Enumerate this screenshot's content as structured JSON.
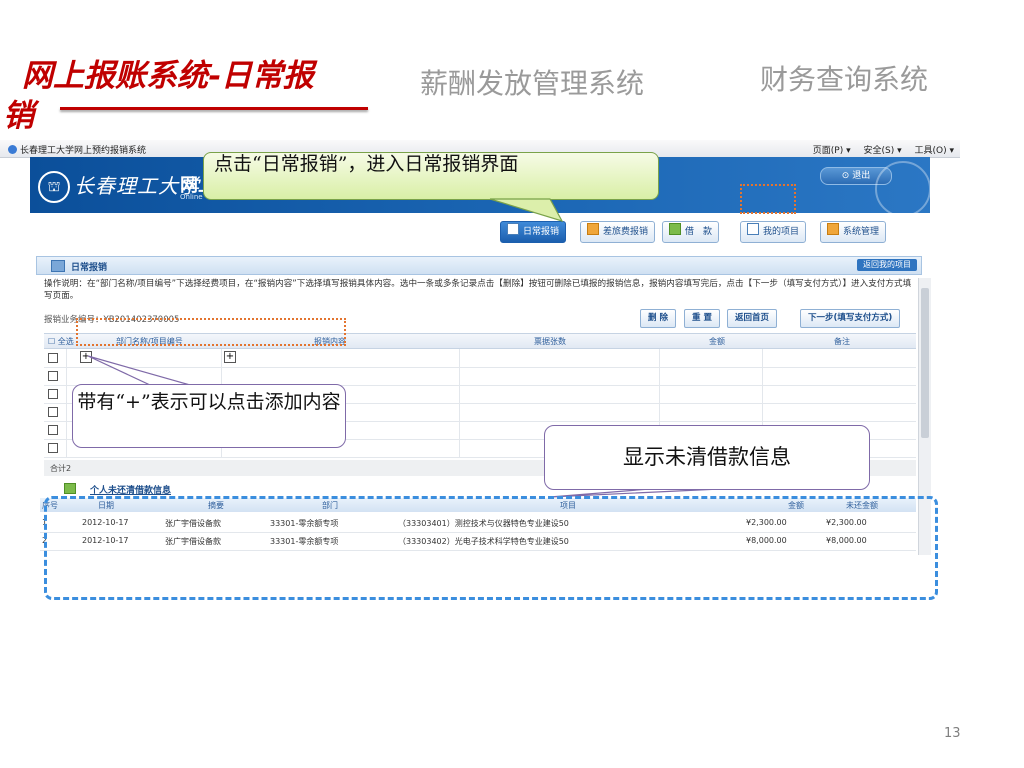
{
  "slide": {
    "title_line1": "网上报账系统-日常报",
    "title_line2": "销",
    "salary_system": "薪酬发放管理系统",
    "finance_system": "财务查询系统",
    "page_number": "13"
  },
  "browser": {
    "tab_title": "长春理工大学网上预约报销系统",
    "tools": [
      "页面(P) ▾",
      "安全(S) ▾",
      "工具(O) ▾"
    ]
  },
  "banner": {
    "university": "长春理工大学",
    "system_prefix": "网上",
    "subtitle": "Online",
    "logout": "退出"
  },
  "nav": {
    "daily": "日常报销",
    "travel": "差旅费报销",
    "loan": "借　款",
    "my_items": "我的项目",
    "admin": "系统管理"
  },
  "panel": {
    "title": "日常报销",
    "my_items_btn": "返回我的项目",
    "instruction": "操作说明：在“部门名称/项目编号”下选择经费项目，在“报销内容”下选择填写报销具体内容。选中一条或多条记录点击【删除】按钮可删除已填报的报销信息，报销内容填写完后，点击【下一步（填写支付方式）】进入支付方式填写页面。",
    "biz_no": "报销业务编号：YB201402370005"
  },
  "actions": {
    "delete": "删 除",
    "reset": "重 置",
    "home": "返回首页",
    "next": "下一步(填写支付方式)"
  },
  "grid": {
    "headers": [
      "全选",
      "部门名称/项目编号",
      "报销内容",
      "票据张数",
      "金额",
      "备注"
    ],
    "row_count": 6,
    "total_label": "合计2"
  },
  "debt": {
    "title": "个人未还清借款信息",
    "headers": [
      "序号",
      "日期",
      "摘要",
      "部门",
      "项目",
      "金额",
      "未还金额"
    ],
    "rows": [
      {
        "no": "1",
        "date": "2012-10-17",
        "summary": "张广宇借设备款",
        "dept": "33301-零余额专项",
        "project": "（33303401）测控技术与仪器特色专业建设50",
        "amount": "¥2,300.00",
        "unpaid": "¥2,300.00"
      },
      {
        "no": "2",
        "date": "2012-10-17",
        "summary": "张广宇借设备款",
        "dept": "33301-零余额专项",
        "project": "（33303402）光电子技术科学特色专业建设50",
        "amount": "¥8,000.00",
        "unpaid": "¥8,000.00"
      }
    ]
  },
  "callouts": {
    "daily": "点击“日常报销”，进入日常报销界面",
    "plus": "带有“+”表示可以点击添加内容",
    "debt": "显示未清借款信息"
  },
  "colors": {
    "title_red": "#c00000",
    "gray_title": "#9a9a9a",
    "banner_blue": "#1b66b4",
    "dash_blue": "#3b8ede",
    "orange_dot": "#e3742f"
  }
}
